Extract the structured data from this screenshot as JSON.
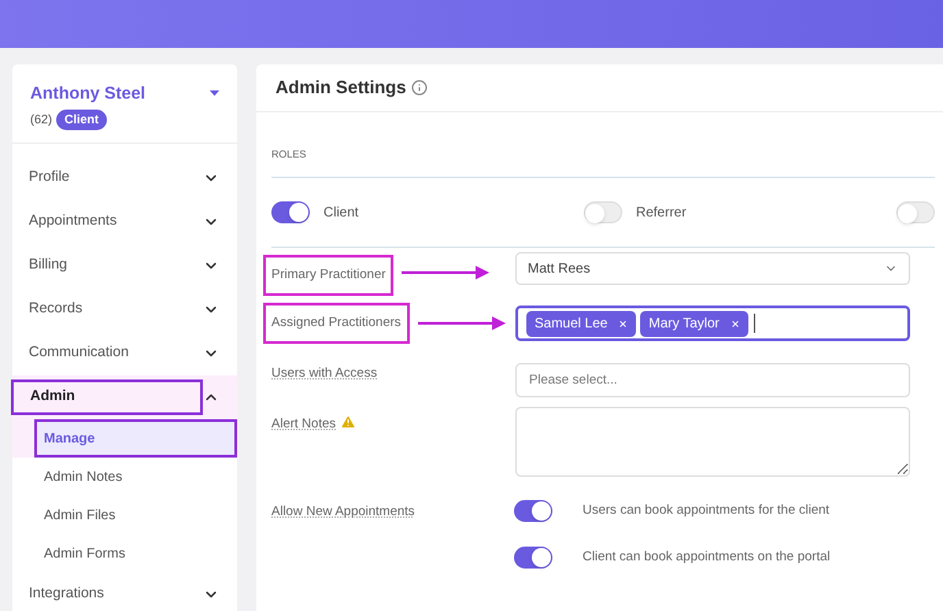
{
  "client": {
    "name": "Anthony Steel",
    "count": "(62)",
    "badge": "Client"
  },
  "sidebar": {
    "items": [
      {
        "label": "Profile",
        "expanded": false,
        "highlighted": false
      },
      {
        "label": "Appointments",
        "expanded": false,
        "highlighted": false
      },
      {
        "label": "Billing",
        "expanded": false,
        "highlighted": false
      },
      {
        "label": "Records",
        "expanded": false,
        "highlighted": false
      },
      {
        "label": "Communication",
        "expanded": false,
        "highlighted": false
      },
      {
        "label": "Admin",
        "expanded": true,
        "highlighted": true,
        "children": [
          {
            "label": "Manage",
            "selected": true,
            "highlighted": true
          },
          {
            "label": "Admin Notes",
            "selected": false,
            "highlighted": false
          },
          {
            "label": "Admin Files",
            "selected": false,
            "highlighted": false
          },
          {
            "label": "Admin Forms",
            "selected": false,
            "highlighted": false
          }
        ]
      },
      {
        "label": "Integrations",
        "expanded": false,
        "highlighted": false
      }
    ]
  },
  "panel": {
    "title": "Admin Settings",
    "section": "ROLES",
    "roles": [
      {
        "label": "Client",
        "on": true
      },
      {
        "label": "Referrer",
        "on": false
      },
      {
        "on": false
      }
    ],
    "fields": [
      {
        "kind": "select",
        "label": "Primary Practitioner",
        "value": "Matt Rees",
        "highlighted": true
      },
      {
        "kind": "tags",
        "label": "Assigned Practitioners",
        "tags": [
          "Samuel Lee",
          "Mary Taylor"
        ],
        "highlighted": true
      },
      {
        "kind": "input",
        "label": "Users with Access",
        "placeholder": "Please select...",
        "highlighted": false
      },
      {
        "kind": "textarea",
        "label": "Alert Notes",
        "warning": true,
        "highlighted": false
      },
      {
        "kind": "toggles",
        "label": "Allow New Appointments",
        "highlighted": false,
        "options": [
          {
            "label": "Users can book appointments for the client",
            "on": true
          },
          {
            "label": "Client can book appointments on the portal",
            "on": true
          }
        ]
      }
    ]
  }
}
